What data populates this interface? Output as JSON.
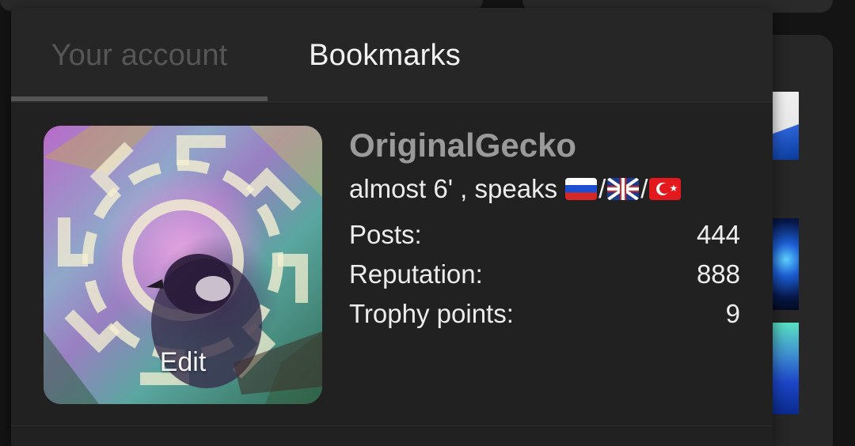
{
  "tabs": [
    {
      "label": "Your account",
      "active": true
    },
    {
      "label": "Bookmarks",
      "active": false
    }
  ],
  "profile": {
    "username": "OriginalGecko",
    "tagline_prefix": "almost 6' , speaks",
    "flags": [
      "russia-flag-icon",
      "uk-flag-icon",
      "turkey-flag-icon"
    ],
    "separator": "/",
    "avatar_edit_label": "Edit"
  },
  "stats": [
    {
      "label": "Posts:",
      "value": "444"
    },
    {
      "label": "Reputation:",
      "value": "888"
    },
    {
      "label": "Trophy points:",
      "value": "9"
    }
  ],
  "colors": {
    "popup_bg": "#212121",
    "tabbar_bg": "#262626",
    "inactive_tab_text": "#565656",
    "active_tab_text": "#f2f2f2",
    "username_text": "#9a9a9a"
  }
}
